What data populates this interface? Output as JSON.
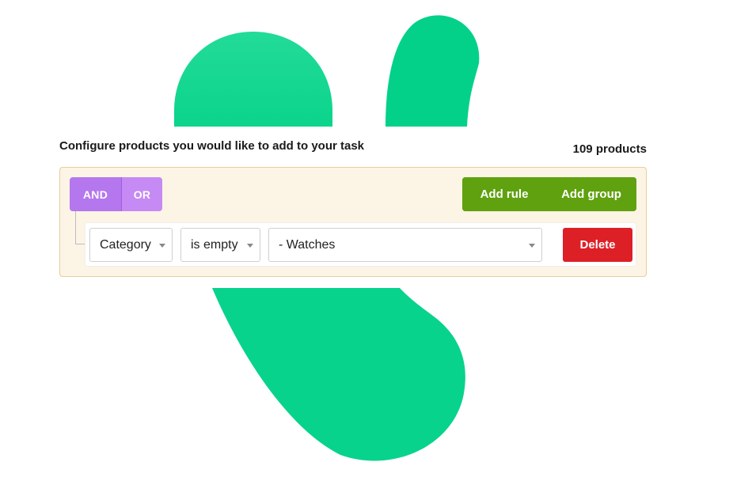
{
  "heading": "Configure products you would like to add to your task",
  "product_count": "109 products",
  "logic": {
    "and_label": "AND",
    "or_label": "OR"
  },
  "actions": {
    "add_rule_label": "Add rule",
    "add_group_label": "Add group"
  },
  "rule": {
    "field": "Category",
    "operator": "is empty",
    "value": "- Watches",
    "delete_label": "Delete"
  },
  "colors": {
    "art_green": "#08d38c",
    "logic_purple": "#c58af4",
    "action_green": "#5fa10f",
    "delete_red": "#dd2026",
    "panel_bg": "#fcf4e5",
    "panel_border": "#e6cf99"
  }
}
